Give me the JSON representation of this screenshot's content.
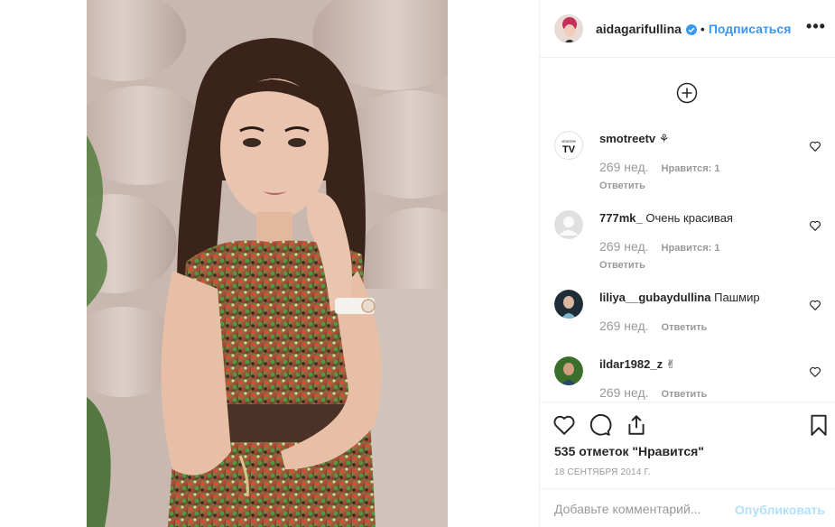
{
  "post": {
    "author": "aidagarifullina",
    "follow_label": "Подписаться",
    "separator": "•",
    "more_label": "•••",
    "likes_text": "535 отметок \"Нравится\"",
    "date": "18 СЕНТЯБРЯ 2014 Г."
  },
  "comments": [
    {
      "user": "smotreetv",
      "text": "⚘",
      "age": "269 нед.",
      "likes": "Нравится: 1",
      "reply": "Ответить",
      "avatar": "tv-logo"
    },
    {
      "user": "777mk_",
      "text": "Очень красивая",
      "age": "269 нед.",
      "likes": "Нравится: 1",
      "reply": "Ответить",
      "avatar": "default-avatar"
    },
    {
      "user": "liliya__gubaydullina",
      "text": "Пашмир",
      "age": "269 нед.",
      "reply": "Ответить",
      "avatar": "photo-avatar"
    },
    {
      "user": "ildar1982_z",
      "text": "✌",
      "age": "269 нед.",
      "reply": "Ответить",
      "avatar": "photo-avatar"
    }
  ],
  "avatar_logo_text": {
    "top": "smotree",
    "bottom": "TV"
  },
  "composer": {
    "placeholder": "Добавьте комментарий...",
    "publish_label": "Опубликовать"
  },
  "icons": {
    "load_more": "plus-circle-icon",
    "like": "heart-icon",
    "comment": "comment-icon",
    "share": "share-icon",
    "save": "bookmark-icon",
    "verified": "verified-badge-icon"
  },
  "colors": {
    "link_blue": "#3897f0",
    "publish_disabled": "#b2dffc",
    "muted": "#999999",
    "text": "#262626",
    "border": "#efefef"
  }
}
